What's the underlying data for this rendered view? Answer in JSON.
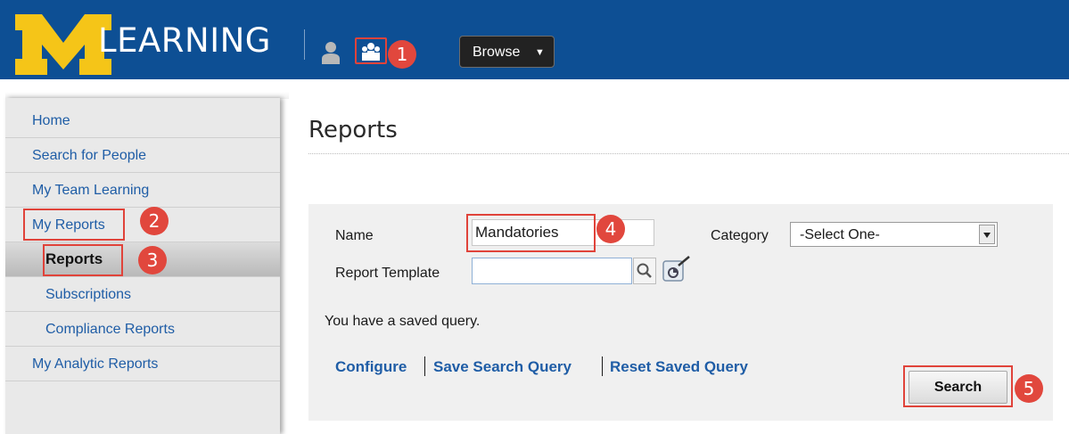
{
  "header": {
    "logo_letter": "M",
    "logo_text": "LEARNING",
    "browse_label": "Browse",
    "brand_color": "#0d4f94",
    "logo_color": "#f5c518"
  },
  "sidebar": {
    "items": [
      {
        "label": "Home"
      },
      {
        "label": "Search for People"
      },
      {
        "label": "My Team Learning"
      },
      {
        "label": "My Reports"
      },
      {
        "label": "Reports",
        "active": true
      },
      {
        "label": "Subscriptions"
      },
      {
        "label": "Compliance Reports"
      },
      {
        "label": "My Analytic Reports"
      }
    ]
  },
  "main": {
    "title": "Reports",
    "name_label": "Name",
    "name_value": "Mandatories",
    "category_label": "Category",
    "category_selected": "-Select One-",
    "template_label": "Report Template",
    "template_value": "",
    "saved_query_text": "You have a saved query.",
    "links": [
      "Configure",
      "Save Search Query",
      "Reset Saved Query"
    ],
    "search_label": "Search"
  },
  "callouts": [
    "1",
    "2",
    "3",
    "4",
    "5"
  ],
  "annotation_color": "#e1473d"
}
